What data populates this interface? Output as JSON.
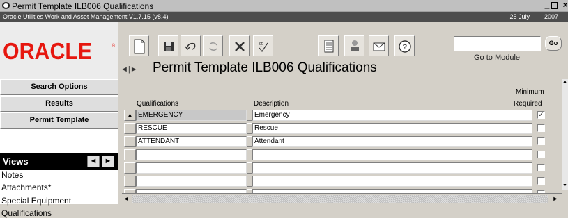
{
  "window": {
    "title": "Permit Template ILB006 Qualifications",
    "app_version": "Oracle Utilities Work and Asset Management V1.7.15 (v8.4)",
    "date": "25 July",
    "year": "2007",
    "controls": [
      "_",
      "□",
      "×"
    ]
  },
  "logo": {
    "text": "ORACLE",
    "registered": "®",
    "color": "#e6170f"
  },
  "toolbar": {
    "icons": [
      "new-document-icon",
      "save-icon",
      "undo-icon",
      "refresh-icon",
      "delete-icon",
      "spellcheck-icon",
      "report-icon",
      "print-icon",
      "mail-icon",
      "help-icon"
    ],
    "spell_label": "sp",
    "goto_placeholder": "",
    "goto_label": "Go to Module",
    "go_label": "Go"
  },
  "heading": {
    "nav": "◄|►",
    "text": "Permit Template ILB006 Qualifications"
  },
  "sidebar": {
    "buttons": [
      "Search Options",
      "Results",
      "Permit Template"
    ],
    "views_label": "Views",
    "view_prev": "◄",
    "view_next": "►",
    "items": [
      "Notes",
      "Attachments*",
      "Special Equipment",
      "Qualifications"
    ]
  },
  "grid": {
    "headers": {
      "qualifications": "Qualifications",
      "description": "Description",
      "minimum": "Minimum",
      "required": "Required"
    },
    "rows": [
      {
        "qualification": "EMERGENCY",
        "description": "Emergency",
        "required": true
      },
      {
        "qualification": "RESCUE",
        "description": "Rescue",
        "required": false
      },
      {
        "qualification": "ATTENDANT",
        "description": "Attendant",
        "required": false
      },
      {
        "qualification": "",
        "description": "",
        "required": false
      },
      {
        "qualification": "",
        "description": "",
        "required": false
      },
      {
        "qualification": "",
        "description": "",
        "required": false
      },
      {
        "qualification": "",
        "description": "",
        "required": false
      }
    ]
  }
}
